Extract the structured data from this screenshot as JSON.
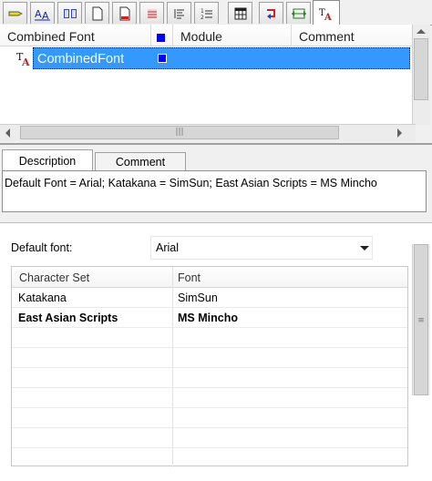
{
  "toolbar": {
    "tabs": [
      {
        "icon": "pencil-icon"
      },
      {
        "icon": "font-icon"
      },
      {
        "icon": "book-icon"
      },
      {
        "icon": "page-icon"
      },
      {
        "icon": "page-red-icon"
      },
      {
        "icon": "lines-icon"
      },
      {
        "icon": "paragraph-icon"
      },
      {
        "icon": "numbered-list-icon"
      },
      {
        "icon": "table-icon"
      },
      {
        "icon": "arrow-return-icon"
      },
      {
        "icon": "resize-icon"
      },
      {
        "icon": "combined-font-icon"
      }
    ]
  },
  "grid": {
    "columns": [
      "Combined Font",
      "Module",
      "Comment"
    ],
    "rows": [
      {
        "name": "CombinedFont"
      }
    ]
  },
  "detail_tabs": [
    "Description",
    "Comment"
  ],
  "description": "Default Font = Arial; Katakana = SimSun; East Asian Scripts = MS Mincho",
  "default_font": {
    "label": "Default font:",
    "value": "Arial"
  },
  "charset_table": {
    "columns": [
      "Character Set",
      "Font"
    ],
    "rows": [
      {
        "charset": "Katakana",
        "font": "SimSun"
      },
      {
        "charset": "East Asian Scripts",
        "font": "MS Mincho"
      }
    ]
  },
  "colors": {
    "selection": "#3399ff",
    "module_marker": "#0000ff"
  }
}
